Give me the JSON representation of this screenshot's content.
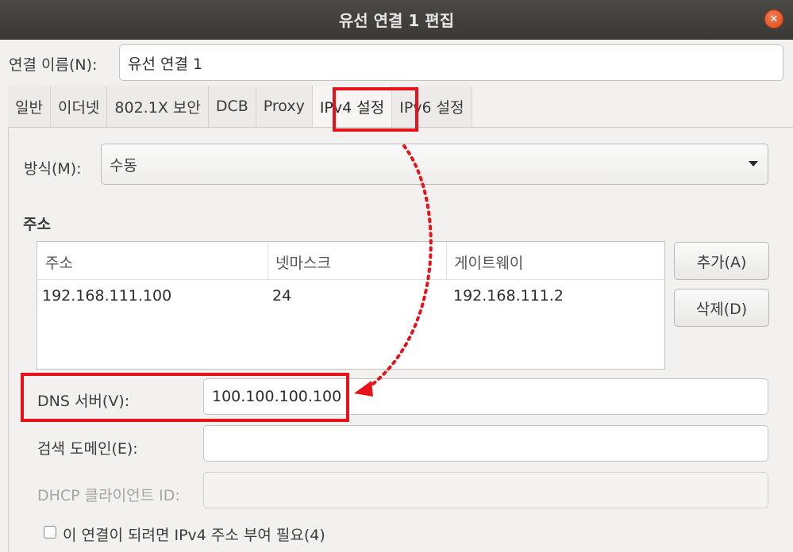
{
  "window": {
    "title": "유선 연결 1 편집",
    "close_symbol": "✕"
  },
  "connection_name": {
    "label": "연결 이름(N):",
    "value": "유선 연결 1"
  },
  "tabs": [
    {
      "label": "일반"
    },
    {
      "label": "이더넷"
    },
    {
      "label": "802.1X 보안"
    },
    {
      "label": "DCB"
    },
    {
      "label": "Proxy"
    },
    {
      "label": "IPv4 설정",
      "active": true
    },
    {
      "label": "IPv6 설정"
    }
  ],
  "method": {
    "label": "방식(M):",
    "value": "수동"
  },
  "addresses": {
    "section_title": "주소",
    "columns": [
      "주소",
      "넷마스크",
      "게이트웨이"
    ],
    "rows": [
      {
        "address": "192.168.111.100",
        "netmask": "24",
        "gateway": "192.168.111.2"
      }
    ],
    "add_label": "추가(A)",
    "delete_label": "삭제(D)"
  },
  "dns": {
    "label": "DNS 서버(V):",
    "value": "100.100.100.100"
  },
  "search_domain": {
    "label": "검색 도메인(E):",
    "value": ""
  },
  "dhcp_client_id": {
    "label": "DHCP 클라이언트 ID:",
    "value": ""
  },
  "require_ipv4": {
    "label": "이 연결이 되려면 IPv4 주소 부여 필요(4)",
    "checked": false
  },
  "colors": {
    "highlight": "#e8121a",
    "titlebar": "#3f3e3a",
    "close": "#df4a16"
  }
}
